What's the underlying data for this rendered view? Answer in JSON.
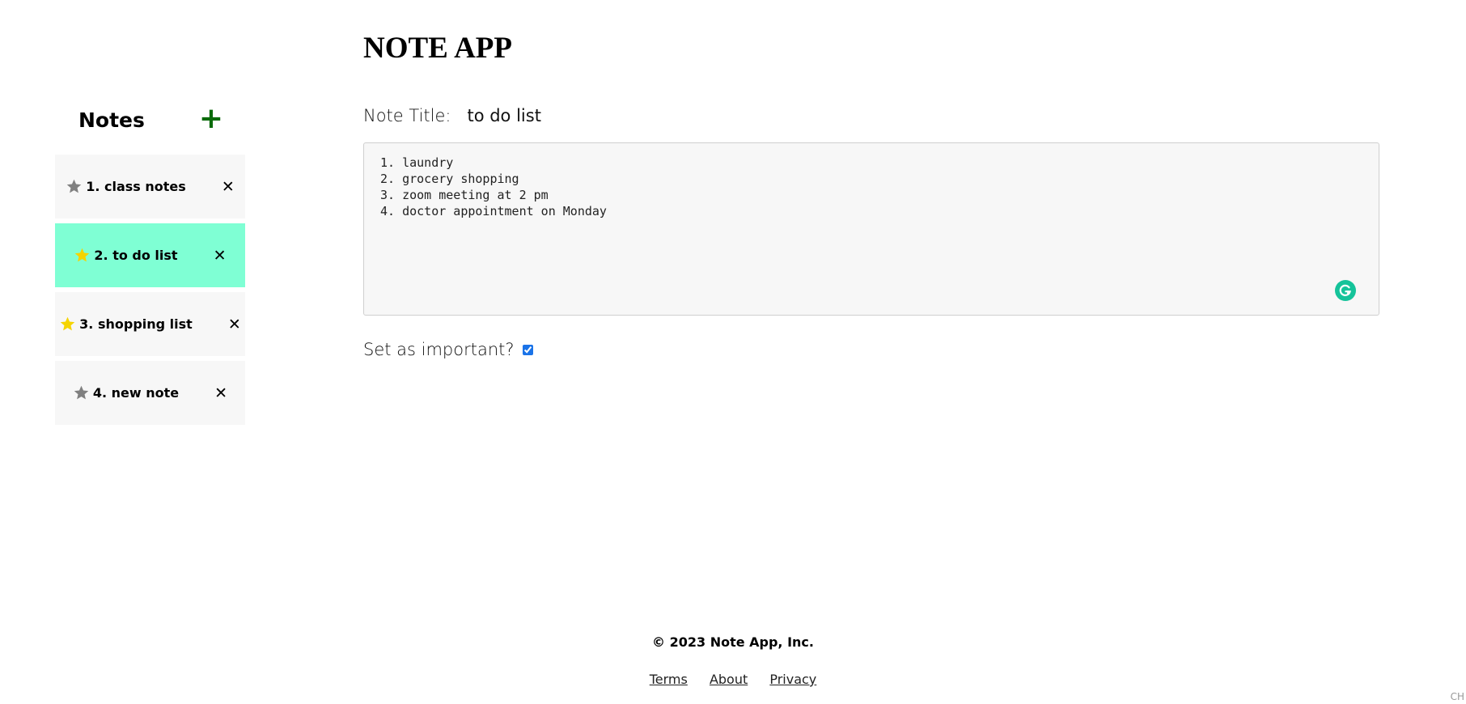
{
  "app": {
    "title": "NOTE APP"
  },
  "sidebar": {
    "title": "Notes",
    "add_label": "+",
    "items": [
      {
        "label": "1. class notes",
        "starred": false,
        "active": false,
        "delete_label": "✕"
      },
      {
        "label": "2. to do list",
        "starred": true,
        "active": true,
        "delete_label": "✕"
      },
      {
        "label": "3. shopping list",
        "starred": true,
        "active": false,
        "delete_label": "✕"
      },
      {
        "label": "4. new note",
        "starred": false,
        "active": false,
        "delete_label": "✕"
      }
    ]
  },
  "editor": {
    "title_label": "Note Title:",
    "title_value": "to do list",
    "body": "1. laundry\n2. grocery shopping\n3. zoom meeting at 2 pm\n4. doctor appointment on Monday",
    "important_label": "Set as important?",
    "important_checked": true
  },
  "footer": {
    "copyright": "© 2023 Note App, Inc.",
    "links": [
      "Terms",
      "About",
      "Privacy"
    ]
  },
  "corner_text": "CH",
  "colors": {
    "active_note_bg": "#7fffd4",
    "note_bg": "#f7f7f7",
    "star_on": "#f5d400",
    "star_off": "#808080",
    "add_button": "#0b6b0b",
    "grammarly": "#15c39a"
  }
}
